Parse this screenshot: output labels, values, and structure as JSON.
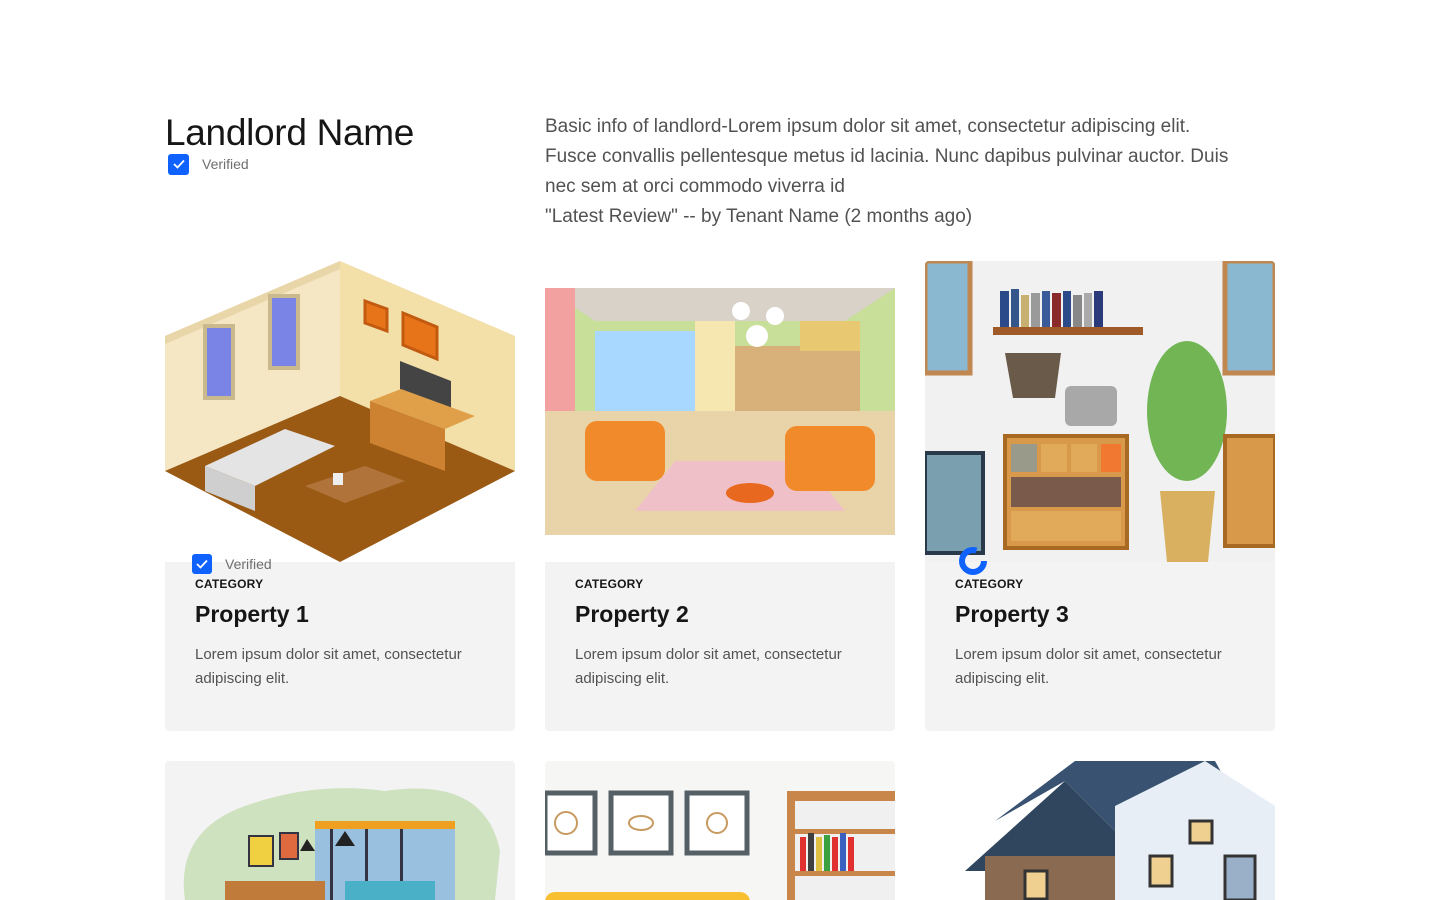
{
  "landlord": {
    "name": "Landlord Name",
    "verified_label": "Verified",
    "about_lines": [
      "Basic info of landlord-Lorem ipsum dolor sit amet, consectetur adipiscing elit.",
      "Fusce convallis pellentesque metus id lacinia. Nunc dapibus pulvinar auctor. Duis",
      "nec sem at orci commodo viverra id",
      "\"Latest Review\" -- by Tenant Name (2 months ago)"
    ]
  },
  "properties": [
    {
      "category": "CATEGORY",
      "title": "Property 1",
      "description": "Lorem ipsum dolor sit amet, consectetur adipiscing elit.",
      "verified_label": "Verified",
      "image_icon": "living-room-illustration"
    },
    {
      "category": "CATEGORY",
      "title": "Property 2",
      "description": "Lorem ipsum dolor sit amet, consectetur adipiscing elit.",
      "image_icon": "lounge-illustration"
    },
    {
      "category": "CATEGORY",
      "title": "Property 3",
      "description": "Lorem ipsum dolor sit amet, consectetur adipiscing elit.",
      "image_icon": "furniture-illustration"
    },
    {
      "image_icon": "interior-illustration"
    },
    {
      "image_icon": "wall-frames-illustration"
    },
    {
      "image_icon": "house-photo"
    }
  ],
  "colors": {
    "accent": "#0f62fe",
    "card_bg": "#f3f3f3",
    "text_primary": "#161616",
    "text_secondary": "#525252"
  }
}
